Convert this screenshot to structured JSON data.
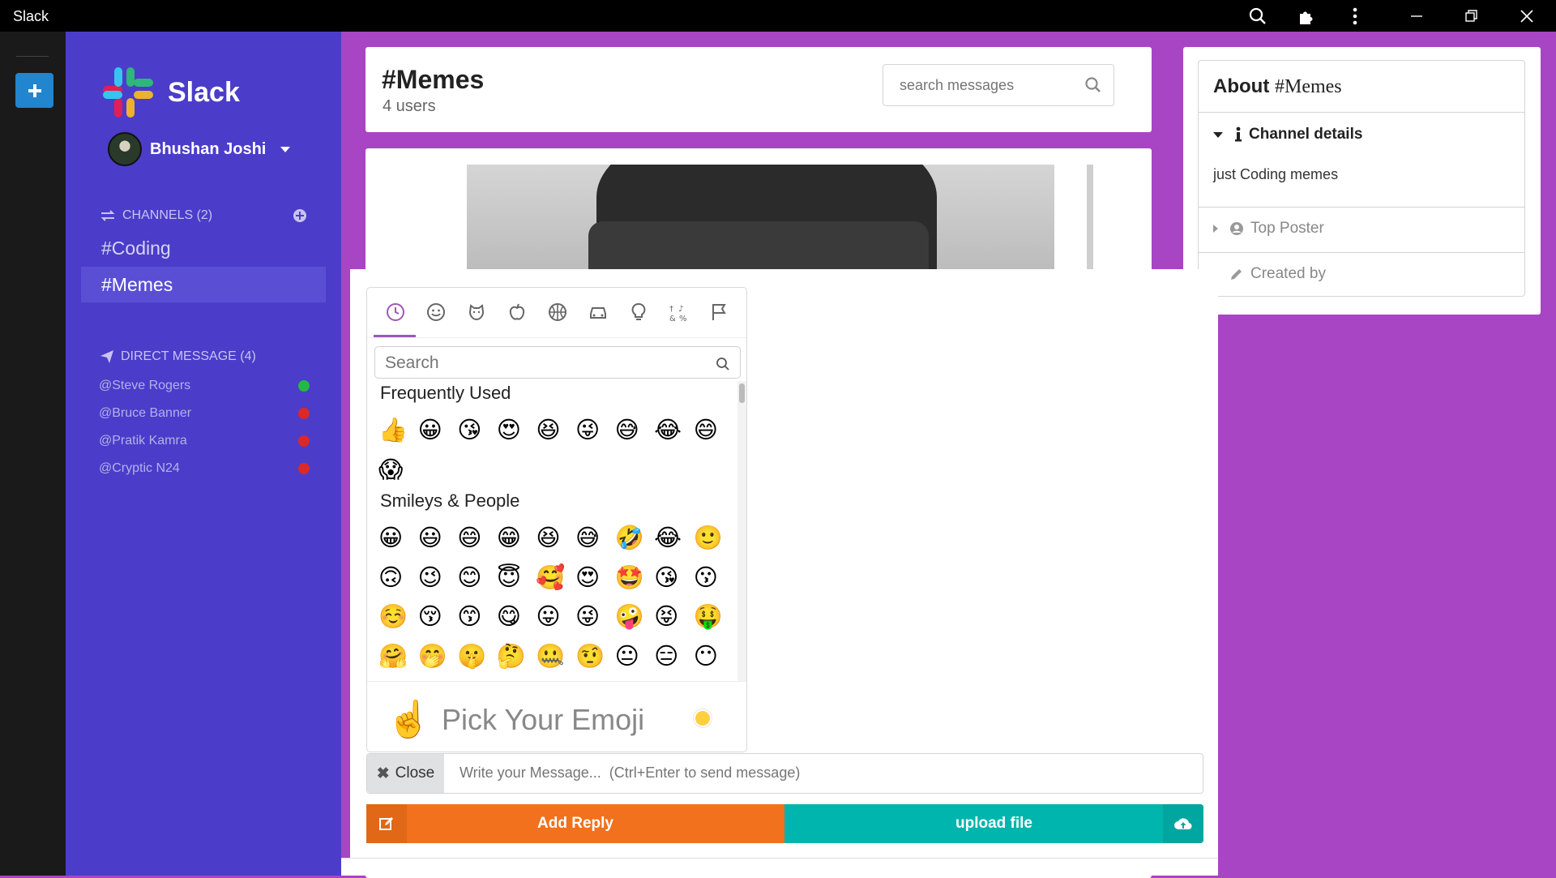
{
  "window": {
    "title": "Slack",
    "controls": [
      "search-icon",
      "extensions-icon",
      "more-vertical-icon",
      "minimize-icon",
      "restore-icon",
      "close-icon"
    ]
  },
  "sidebar": {
    "brand": "Slack",
    "user": {
      "name": "Bhushan Joshi"
    },
    "channels_header": "CHANNELS (2)",
    "channels": [
      {
        "label": "#Coding",
        "active": false
      },
      {
        "label": "#Memes",
        "active": true
      }
    ],
    "dm_header": "DIRECT MESSAGE (4)",
    "dms": [
      {
        "label": "@Steve Rogers",
        "status": "online",
        "color": "#21ba45"
      },
      {
        "label": "@Bruce Banner",
        "status": "offline",
        "color": "#db2828"
      },
      {
        "label": "@Pratik Kamra",
        "status": "offline",
        "color": "#db2828"
      },
      {
        "label": "@Cryptic N24",
        "status": "offline",
        "color": "#db2828"
      }
    ]
  },
  "header": {
    "channel": "#Memes",
    "users": "4 users",
    "search_placeholder": "search messages"
  },
  "about": {
    "title_prefix": "About ",
    "title_channel": "#Memes",
    "sections": {
      "details": "Channel details",
      "details_text": "just Coding memes",
      "top_poster": "Top Poster",
      "created_by": "Created by"
    }
  },
  "emoji_picker": {
    "categories": [
      "recent-icon",
      "smiley-icon",
      "animal-icon",
      "food-icon",
      "activity-icon",
      "travel-icon",
      "objects-icon",
      "symbols-icon",
      "flags-icon"
    ],
    "search_placeholder": "Search",
    "frequently_used_title": "Frequently Used",
    "frequently_used": [
      "👍",
      "😀",
      "😘",
      "😍",
      "😆",
      "😜",
      "😅",
      "😂",
      "😄",
      "😱"
    ],
    "smileys_title": "Smileys & People",
    "smileys": [
      "😀",
      "😃",
      "😄",
      "😁",
      "😆",
      "😅",
      "🤣",
      "😂",
      "🙂",
      "🙃",
      "😉",
      "😊",
      "😇",
      "🥰",
      "😍",
      "🤩",
      "😘",
      "😗",
      "☺️",
      "😚",
      "😙",
      "😋",
      "😛",
      "😜",
      "🤪",
      "😝",
      "🤑",
      "🤗",
      "🤭",
      "🤫",
      "🤔",
      "🤐",
      "🤨",
      "😐",
      "😑",
      "😶"
    ],
    "preview_emoji": "☝️",
    "preview_text": "Pick Your Emoji",
    "skin_tone_color": "#ffcf40"
  },
  "composer": {
    "close_label": "Close",
    "message_placeholder": "Write your Message...  (Ctrl+Enter to send message)",
    "add_reply_label": "Add Reply",
    "upload_label": "upload file"
  },
  "colors": {
    "sidebar": "#4b3dc9",
    "background": "#a845c4",
    "reply": "#f2711c",
    "upload": "#00b5ad"
  }
}
